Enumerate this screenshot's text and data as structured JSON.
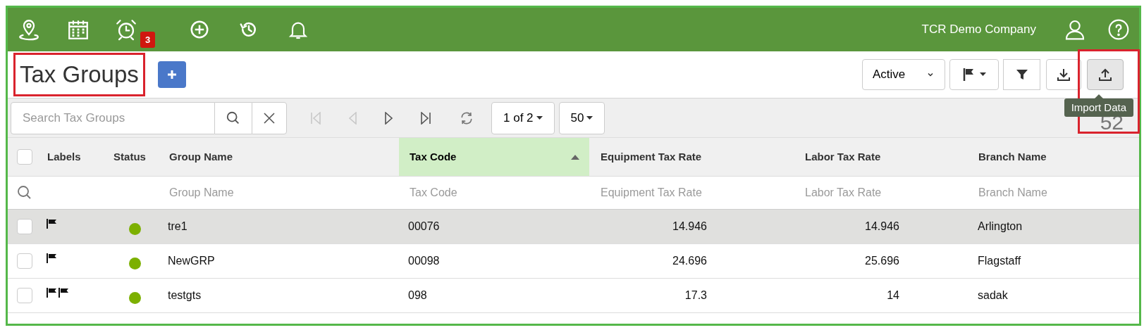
{
  "top_bar": {
    "badge": "3",
    "company": "TCR Demo Company"
  },
  "title": "Tax Groups",
  "status_filter": {
    "value": "Active"
  },
  "search": {
    "placeholder": "Search Tax Groups"
  },
  "pager": {
    "page": "1 of 2",
    "page_size": "50"
  },
  "count": "52",
  "tooltip": "Import Data",
  "table": {
    "select_all_checked": false,
    "columns": [
      {
        "label": "Labels",
        "sorted": false
      },
      {
        "label": "Status",
        "sorted": false
      },
      {
        "label": "Group Name",
        "filter_placeholder": "Group Name",
        "sorted": false
      },
      {
        "label": "Tax Code",
        "filter_placeholder": "Tax Code",
        "sorted": true
      },
      {
        "label": "Equipment Tax Rate",
        "filter_placeholder": "Equipment Tax Rate",
        "sorted": false
      },
      {
        "label": "Labor Tax Rate",
        "filter_placeholder": "Labor Tax Rate",
        "sorted": false
      },
      {
        "label": "Branch Name",
        "filter_placeholder": "Branch Name",
        "sorted": false
      }
    ],
    "rows": [
      {
        "selected": true,
        "checked": false,
        "labels": [
          {
            "kind": "flag"
          }
        ],
        "active": true,
        "cells": [
          "",
          "",
          "tre1",
          "00076",
          "14.946",
          "14.946",
          "Arlington"
        ]
      },
      {
        "selected": false,
        "checked": false,
        "labels": [
          {
            "kind": "flag"
          }
        ],
        "active": true,
        "cells": [
          "",
          "",
          "NewGRP",
          "00098",
          "24.696",
          "25.696",
          "Flagstaff"
        ]
      },
      {
        "selected": false,
        "checked": false,
        "labels": [
          {
            "kind": "flag"
          },
          {
            "kind": "flag"
          }
        ],
        "active": true,
        "cells": [
          "",
          "",
          "testgts",
          "098",
          "17.3",
          "14",
          "sadak"
        ]
      }
    ]
  }
}
